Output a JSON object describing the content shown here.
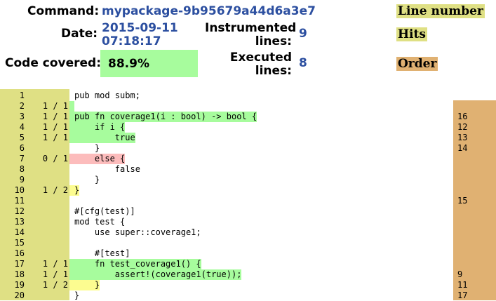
{
  "header": {
    "command_label": "Command:",
    "command_value": "mypackage-9b95679a44d6a3e7",
    "date_label": "Date:",
    "date_value_1": "2015-09-11",
    "date_value_2": "07:18:17",
    "instrumented_label_1": "Instrumented",
    "instrumented_label_2": "lines:",
    "instrumented_value": "9",
    "executed_label_1": "Executed",
    "executed_label_2": "lines:",
    "executed_value": "8",
    "covered_label": "Code covered:",
    "covered_value": "88.9%"
  },
  "legend": {
    "line_number": "Line number",
    "hits": "Hits",
    "order": "Order"
  },
  "colors": {
    "covered": "#a7fc9d",
    "uncovered": "#fcbcbc",
    "partial": "#fcfc90",
    "line_number_bg": "#dfe084",
    "order_bg": "#e0b172",
    "value_blue": "#2c4fa0"
  },
  "lines": [
    {
      "n": "1",
      "hits": "",
      "code": "pub mod subm;",
      "status": "",
      "order": ""
    },
    {
      "n": "2",
      "hits": "1 / 1",
      "code": "",
      "status": "g",
      "order": ""
    },
    {
      "n": "3",
      "hits": "1 / 1",
      "code": "pub fn coverage1(i : bool) -> bool {",
      "status": "g",
      "order": "16"
    },
    {
      "n": "4",
      "hits": "1 / 1",
      "code": "    if i {",
      "status": "g",
      "order": "12"
    },
    {
      "n": "5",
      "hits": "1 / 1",
      "code": "        true",
      "status": "g",
      "order": "13"
    },
    {
      "n": "6",
      "hits": "",
      "code": "    }",
      "status": "",
      "order": "14"
    },
    {
      "n": "7",
      "hits": "0 / 1",
      "code": "    else {",
      "status": "r",
      "order": ""
    },
    {
      "n": "8",
      "hits": "",
      "code": "        false",
      "status": "",
      "order": ""
    },
    {
      "n": "9",
      "hits": "",
      "code": "    }",
      "status": "",
      "order": ""
    },
    {
      "n": "10",
      "hits": "1 / 2",
      "code": "}",
      "status": "y",
      "order": ""
    },
    {
      "n": "11",
      "hits": "",
      "code": "",
      "status": "",
      "order": "15"
    },
    {
      "n": "12",
      "hits": "",
      "code": "#[cfg(test)]",
      "status": "",
      "order": ""
    },
    {
      "n": "13",
      "hits": "",
      "code": "mod test {",
      "status": "",
      "order": ""
    },
    {
      "n": "14",
      "hits": "",
      "code": "    use super::coverage1;",
      "status": "",
      "order": ""
    },
    {
      "n": "15",
      "hits": "",
      "code": "",
      "status": "",
      "order": ""
    },
    {
      "n": "16",
      "hits": "",
      "code": "    #[test]",
      "status": "",
      "order": ""
    },
    {
      "n": "17",
      "hits": "1 / 1",
      "code": "    fn test_coverage1() {",
      "status": "g",
      "order": ""
    },
    {
      "n": "18",
      "hits": "1 / 1",
      "code": "        assert!(coverage1(true));",
      "status": "g",
      "order": "9"
    },
    {
      "n": "19",
      "hits": "1 / 2",
      "code": "    }",
      "status": "y",
      "order": "11"
    },
    {
      "n": "20",
      "hits": "",
      "code": "}",
      "status": "",
      "order": "17"
    }
  ]
}
